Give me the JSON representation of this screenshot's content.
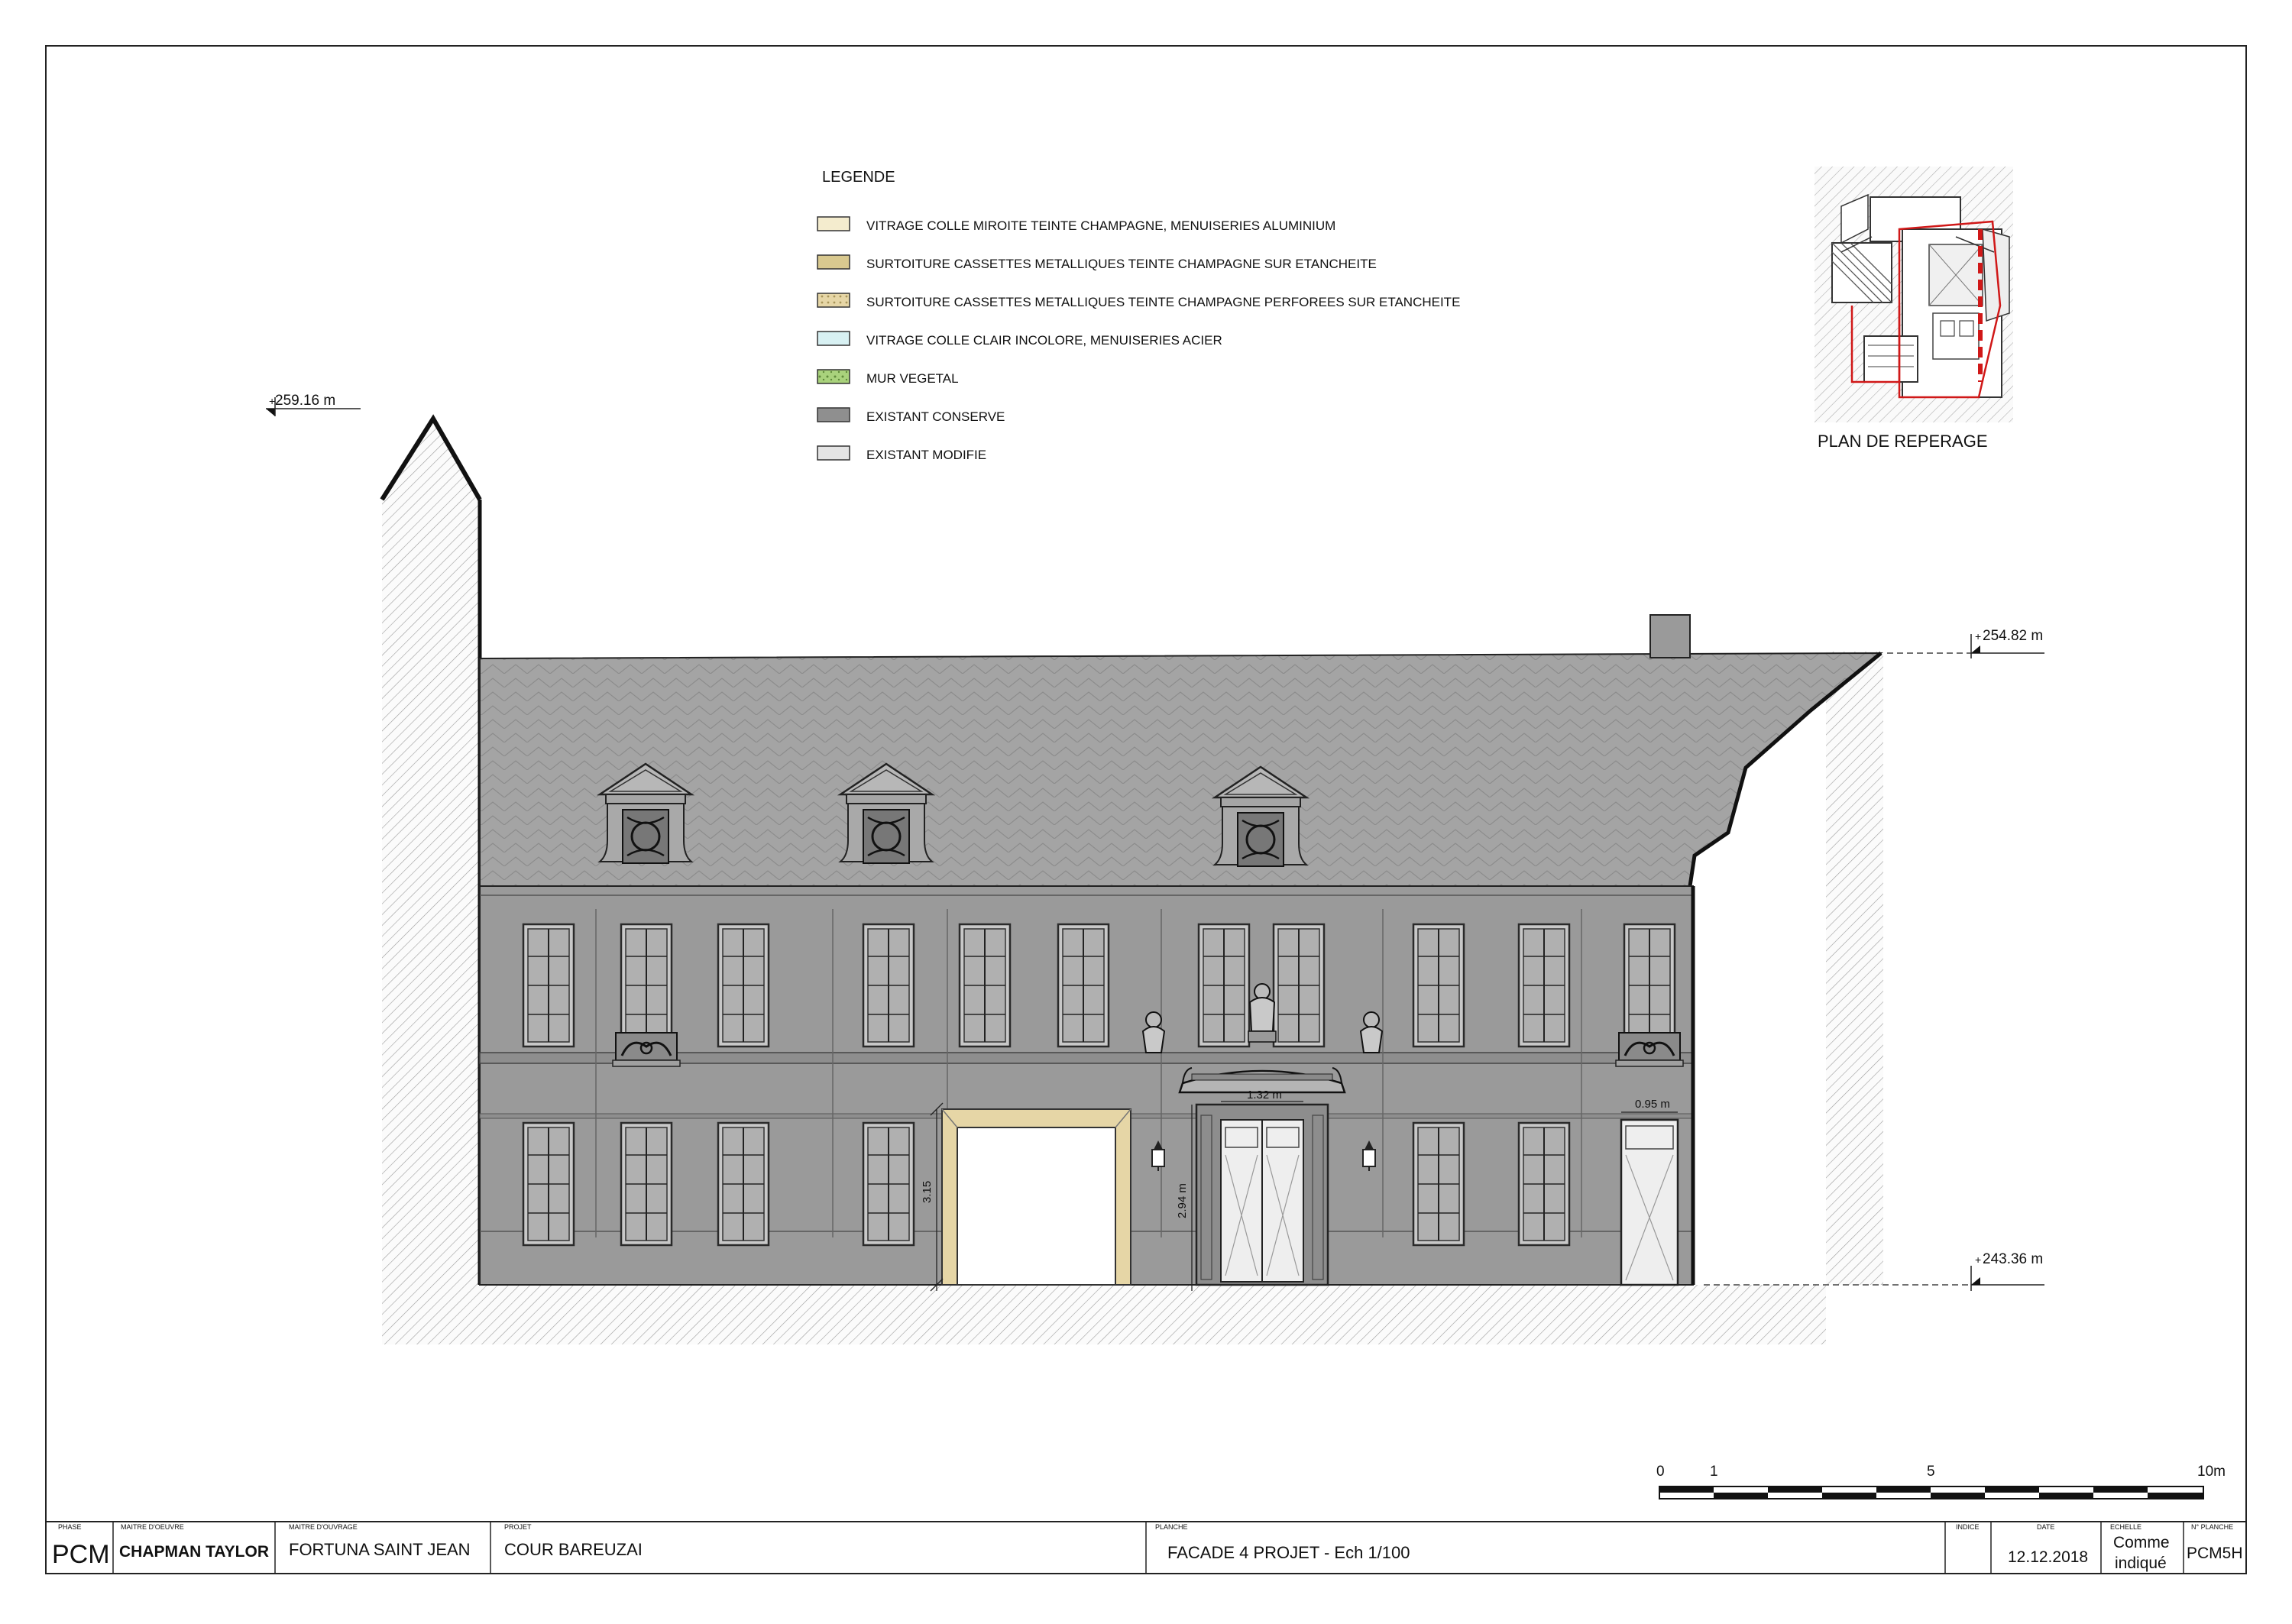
{
  "legend": {
    "title": "LEGENDE",
    "items": [
      {
        "label": "VITRAGE COLLE MIROITE TEINTE CHAMPAGNE, MENUISERIES ALUMINIUM",
        "color": "#f4ecce"
      },
      {
        "label": "SURTOITURE CASSETTES METALLIQUES TEINTE CHAMPAGNE SUR ETANCHEITE",
        "color": "#d9c98f"
      },
      {
        "label": "SURTOITURE CASSETTES METALLIQUES TEINTE CHAMPAGNE PERFOREES SUR ETANCHEITE",
        "color": "#e6d6a6"
      },
      {
        "label": "VITRAGE COLLE CLAIR INCOLORE, MENUISERIES ACIER",
        "color": "#d8f1f3"
      },
      {
        "label": "MUR VEGETAL",
        "color": "#a9d27c"
      },
      {
        "label": "EXISTANT CONSERVE",
        "color": "#8f8f8f"
      },
      {
        "label": "EXISTANT MODIFIE",
        "color": "#e4e4e4"
      }
    ]
  },
  "location_plan": {
    "label": "PLAN DE REPERAGE"
  },
  "levels": {
    "top_left": "259.16 m",
    "top_right": "254.82 m",
    "ground_right": "243.36 m"
  },
  "dimensions": {
    "arch_height": "3.15",
    "door_height": "2.94 m",
    "door_width": "1.32 m",
    "window_width": "0.95 m"
  },
  "scale_bar": {
    "labels": [
      "0",
      "1",
      "5",
      "10m"
    ]
  },
  "title_block": {
    "phase_head": "PHASE",
    "phase": "PCM",
    "architect_head": "MAITRE D'OEUVRE",
    "architect": "CHAPMAN TAYLOR",
    "client_head": "MAITRE D'OUVRAGE",
    "client": "FORTUNA SAINT JEAN",
    "project_head": "PROJET",
    "project": "COUR BAREUZAI",
    "sheet_head": "PLANCHE",
    "sheet": "FACADE 4 PROJET - Ech 1/100",
    "index_head": "INDICE",
    "index": "",
    "date_head": "DATE",
    "date": "12.12.2018",
    "scale_head": "ECHELLE",
    "scale_line1": "Comme",
    "scale_line2": "indiqué",
    "number_head": "N° PLANCHE",
    "number": "PCM5H"
  },
  "colors": {
    "facade": "#9a9a9a",
    "roof": "#a2a2a2",
    "neighbor": "#f7f7f7",
    "stone_frame": "#e6d6a6",
    "plan_red": "#d01818"
  }
}
